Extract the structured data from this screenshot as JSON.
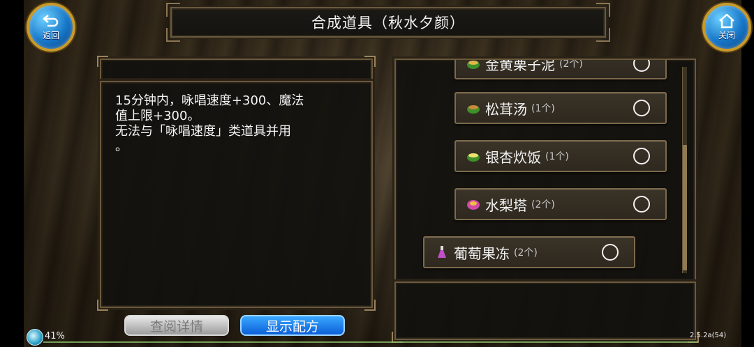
{
  "title": "合成道具（秋水夕颜）",
  "buttons": {
    "back": "返回",
    "close": "关闭",
    "view_details": "查阅详情",
    "show_recipe": "显示配方"
  },
  "description": "15分钟内，咏唱速度+300、魔法\n值上限+300。\n无法与「咏唱速度」类道具并用\n。",
  "items": [
    {
      "name": "金黄栗子泥",
      "qty": "(2个)",
      "icon": "food-bowl-icon",
      "selected": false
    },
    {
      "name": "松茸汤",
      "qty": "(1个)",
      "icon": "food-bowl-icon",
      "selected": false
    },
    {
      "name": "银杏炊饭",
      "qty": "(1个)",
      "icon": "food-bowl-icon",
      "selected": false
    },
    {
      "name": "水梨塔",
      "qty": "(2个)",
      "icon": "tart-icon",
      "selected": false
    },
    {
      "name": "葡萄果冻",
      "qty": "(2个)",
      "icon": "potion-icon",
      "selected": false
    }
  ],
  "status": {
    "battery": "41%",
    "version": "2.5.2a(54)"
  },
  "colors": {
    "panel_border": "#6b5a3d",
    "button_blue": "#0c5fd8",
    "round_button_ring": "#c79a2c"
  }
}
